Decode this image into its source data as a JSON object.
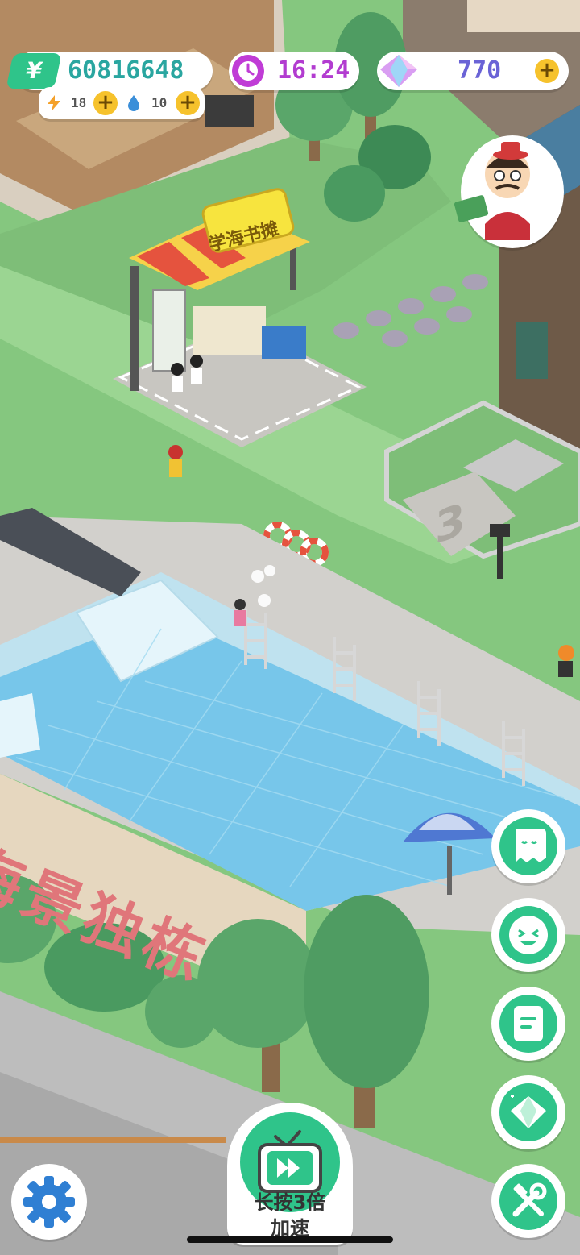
{
  "hud": {
    "money": "60816648",
    "energy": "18",
    "water": "10",
    "time": "16:24",
    "gems": "770"
  },
  "scene": {
    "stall_sign": "学海书摊",
    "wall_text": "海景独栋",
    "area_number": "3"
  },
  "speed_button": {
    "line1": "长按3倍",
    "line2": "加速"
  },
  "colors": {
    "accent_green": "#2fc48a",
    "money_text": "#2aa6a0",
    "time_text": "#b23cd0",
    "gem_text": "#6a63d6",
    "plus_yellow": "#f6c22c"
  }
}
